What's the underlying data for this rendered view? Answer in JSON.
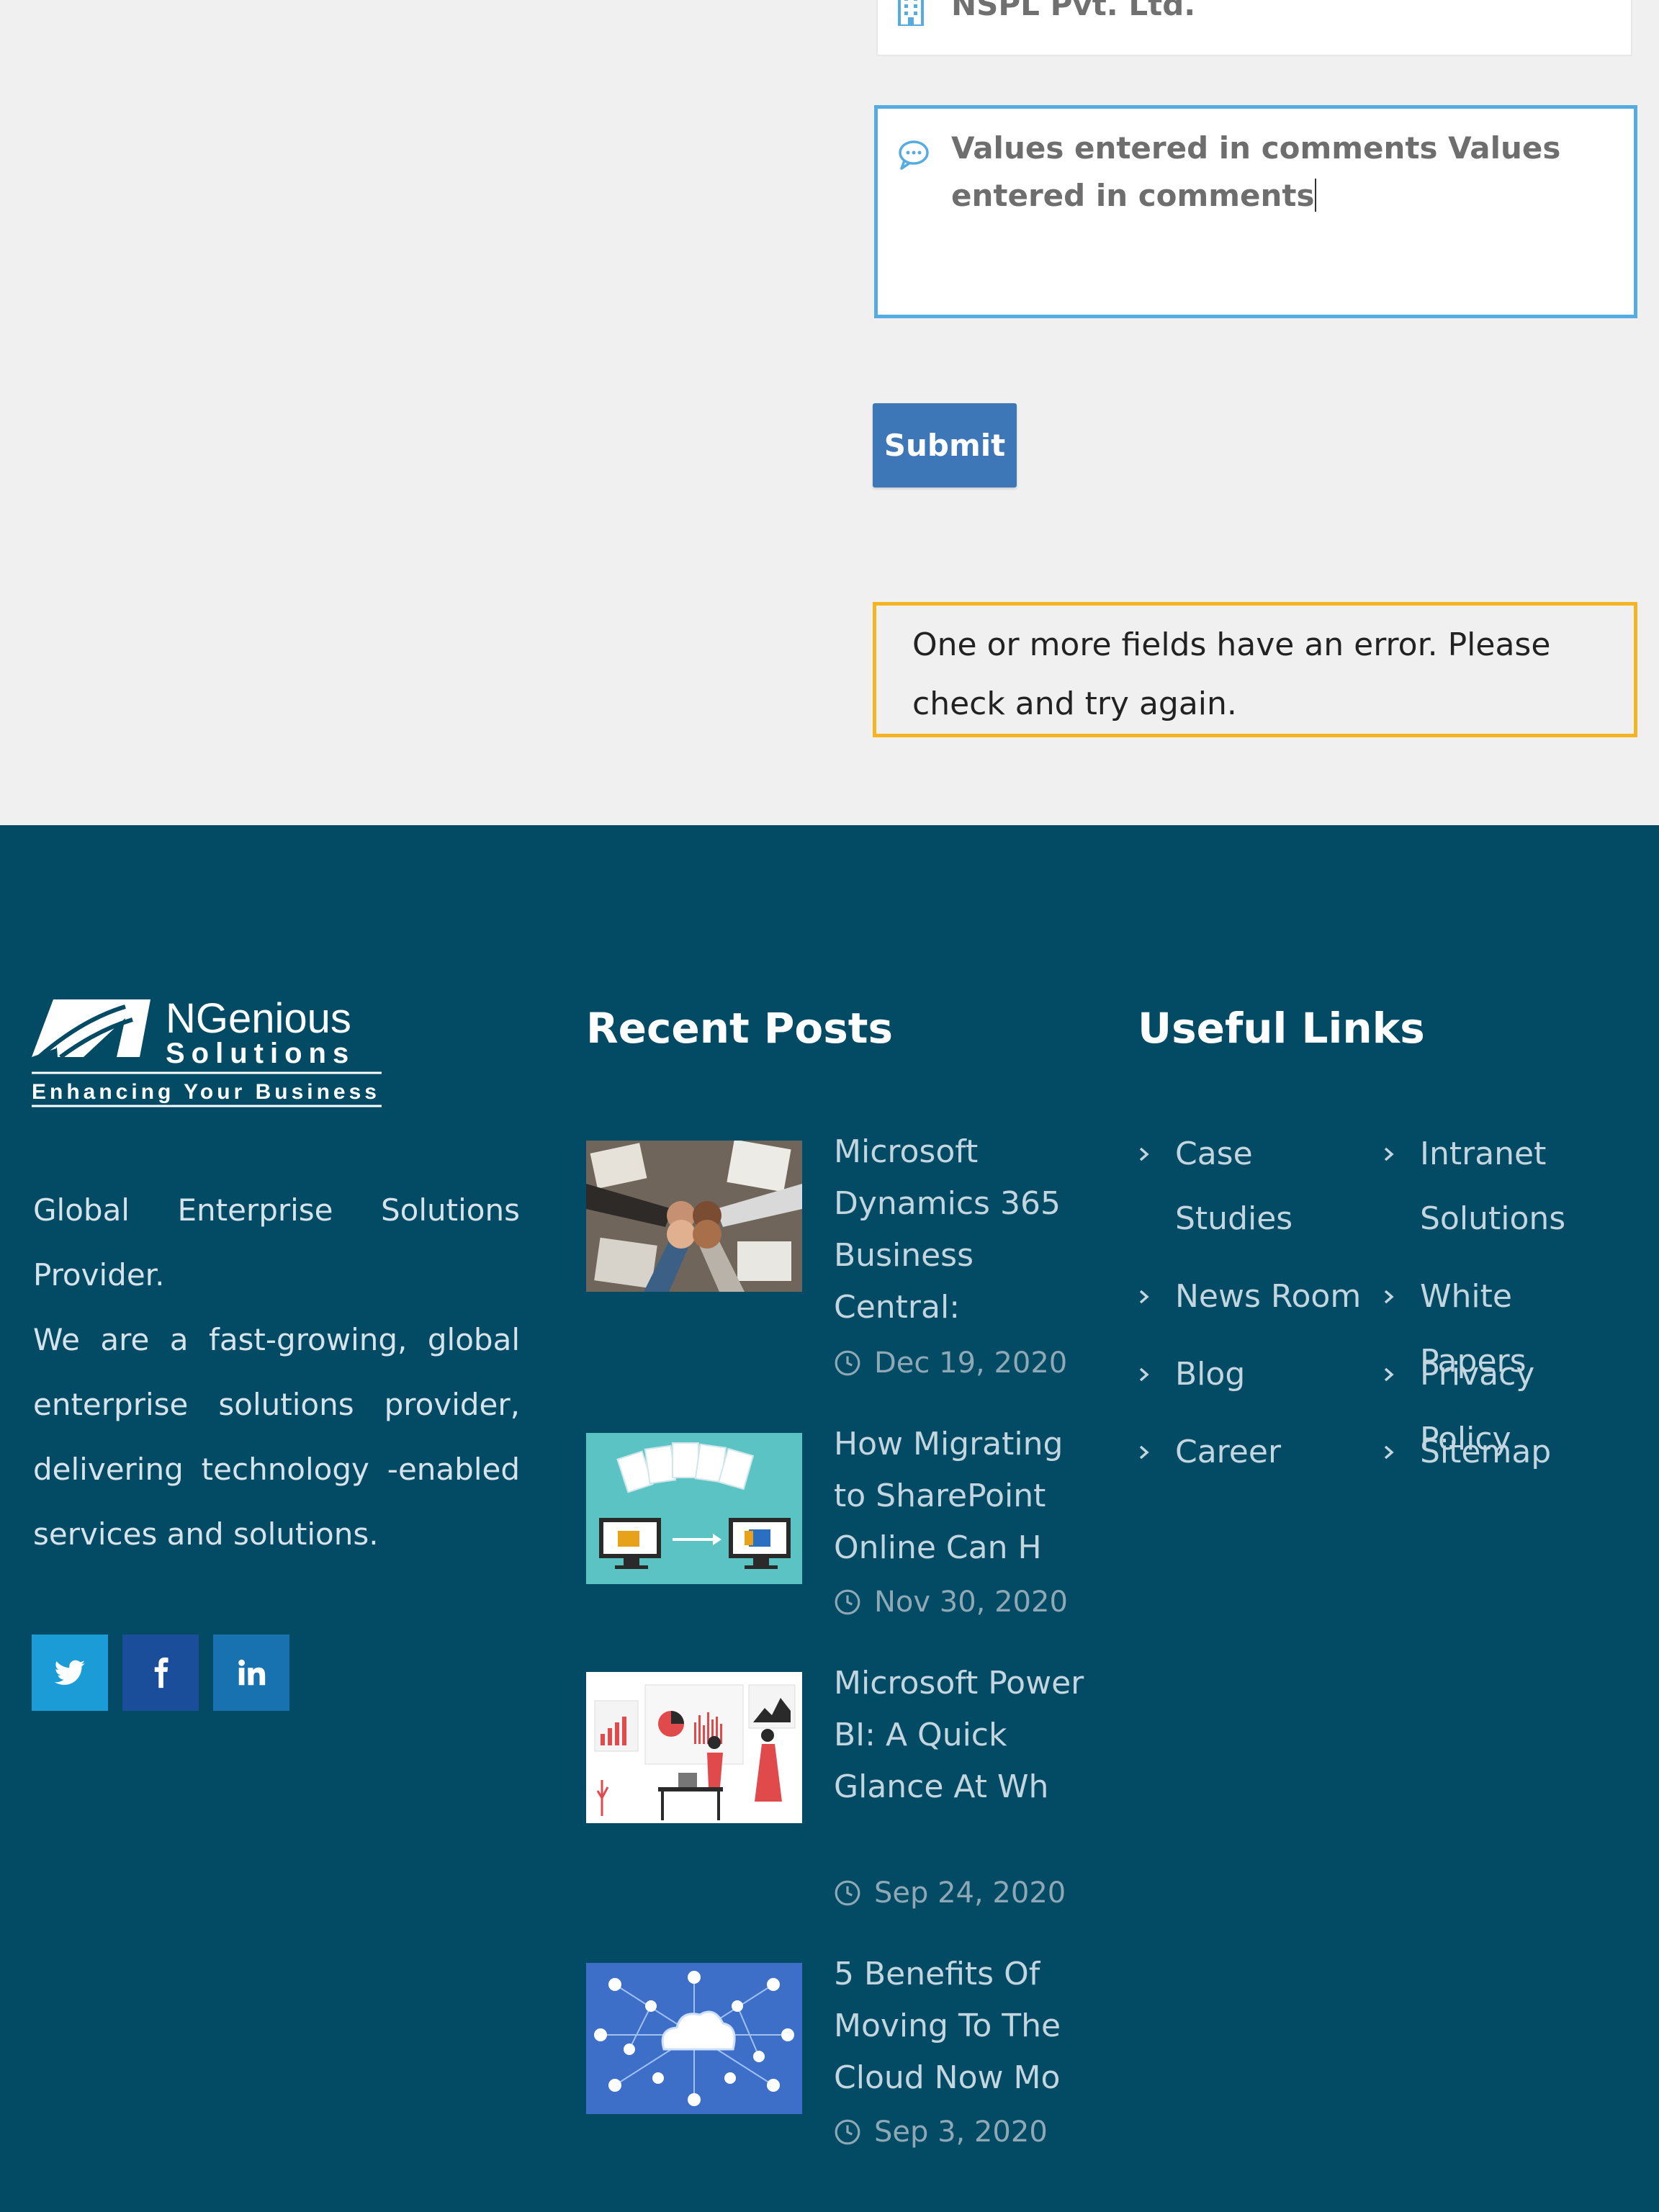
{
  "form": {
    "company_value": "NSPL Pvt. Ltd.",
    "comments_value": "Values entered in comments Values entered in comments",
    "submit_label": "Submit",
    "error_message": "One or more fields have an error. Please check and try again."
  },
  "footer": {
    "logo_text": "NGenious",
    "logo_subtext": "Solutions",
    "logo_tagline": "Enhancing Your Business",
    "about_line1": "Global Enterprise Solutions Provider.",
    "about_line2": "We are a fast-growing, global enterprise solutions provider, delivering technology -enabled services and solutions.",
    "social": [
      "twitter-icon",
      "facebook-icon",
      "linkedin-icon"
    ],
    "recent_posts_title": "Recent Posts",
    "posts": [
      {
        "title": "Microsoft Dynamics 365 Business Central:",
        "date": "Dec 19, 2020"
      },
      {
        "title": "How Migrating to SharePoint Online Can H",
        "date": "Nov 30, 2020"
      },
      {
        "title": "Microsoft Power BI: A Quick Glance At Wh",
        "date": "Sep 24, 2020"
      },
      {
        "title": "5 Benefits Of Moving To The Cloud Now Mo",
        "date": "Sep 3, 2020"
      }
    ],
    "useful_links_title": "Useful Links",
    "links_left": [
      "Case Studies",
      "News Room",
      "Blog",
      "Career"
    ],
    "links_right": [
      "Intranet Solutions",
      "White Papers",
      "Privacy Policy",
      "Sitemap"
    ]
  },
  "colors": {
    "footer_bg": "#034b64",
    "submit_bg": "#3d77b8",
    "comments_border": "#55ace0",
    "error_border": "#f3b521"
  }
}
